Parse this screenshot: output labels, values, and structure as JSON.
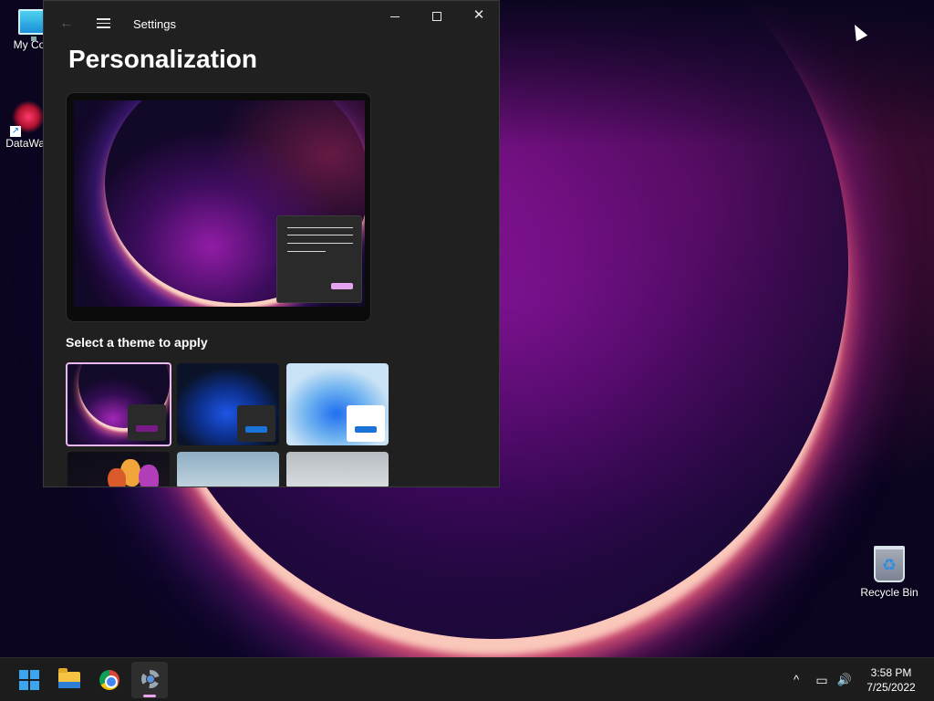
{
  "desktop": {
    "icons": [
      {
        "label": "My Com",
        "icon": "monitor-icon"
      },
      {
        "label": "DataWag",
        "icon": "datawagon-icon"
      },
      {
        "label": "Recycle Bin",
        "icon": "recycle-bin-icon"
      }
    ]
  },
  "window": {
    "title": "Settings",
    "back_icon": "back-arrow-icon",
    "menu_icon": "hamburger-menu-icon",
    "controls": [
      "minimize-icon",
      "maximize-icon",
      "close-icon"
    ],
    "close_glyph": "✕"
  },
  "page": {
    "title": "Personalization",
    "section_label": "Select a theme to apply"
  },
  "themes": [
    {
      "name": "dark-glow-theme",
      "selected": true,
      "accent": "#7a1a86"
    },
    {
      "name": "bloom-dark-theme",
      "selected": false,
      "accent": "#1a73d8"
    },
    {
      "name": "bloom-light-theme",
      "selected": false,
      "accent": "#1a73d8"
    },
    {
      "name": "flower-theme",
      "selected": false
    },
    {
      "name": "sky-theme",
      "selected": false
    },
    {
      "name": "stone-theme",
      "selected": false
    }
  ],
  "taskbar": {
    "apps": [
      "start-icon",
      "file-explorer-icon",
      "chrome-icon",
      "settings-icon"
    ],
    "active_app": "settings-icon",
    "tray": {
      "chevron": "^",
      "network_icon": "network-icon",
      "volume_icon": "volume-icon",
      "network_glyph": "▭",
      "volume_glyph": "🔊"
    },
    "clock": {
      "time": "3:58 PM",
      "date": "7/25/2022"
    }
  },
  "colors": {
    "accent": "#e9a6ef",
    "window_bg": "#202020",
    "taskbar_bg": "#1c1c1c"
  }
}
